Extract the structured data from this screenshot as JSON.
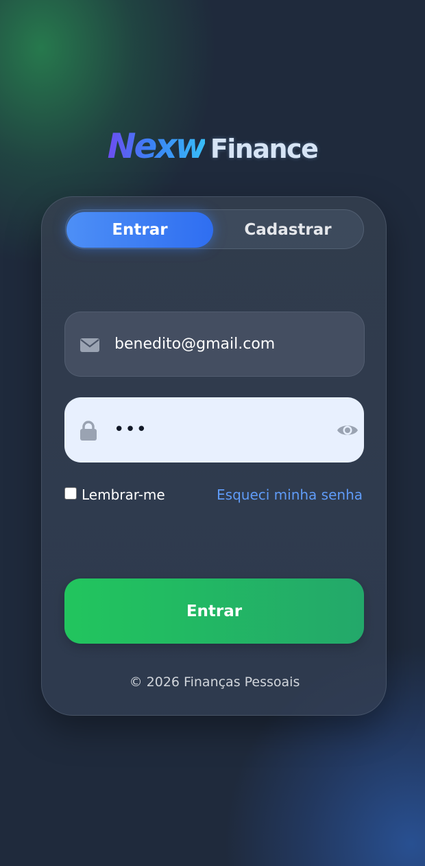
{
  "logo": {
    "brand": "Nexw",
    "word": "Finance"
  },
  "tabs": [
    {
      "label": "Entrar",
      "active": true
    },
    {
      "label": "Cadastrar",
      "active": false
    }
  ],
  "email": {
    "icon": "envelope-icon",
    "value": "benedito@gmail.com"
  },
  "password": {
    "icon": "lock-icon",
    "value": "•••",
    "toggle_icon": "eye-icon"
  },
  "remember": {
    "label": "Lembrar-me",
    "checked": false
  },
  "forgot_label": "Esqueci minha senha",
  "submit_label": "Entrar",
  "footer": "© 2026 Finanças Pessoais",
  "colors": {
    "primary": "#3b82f6",
    "success": "#22c55e",
    "link": "#5f9bf7"
  }
}
